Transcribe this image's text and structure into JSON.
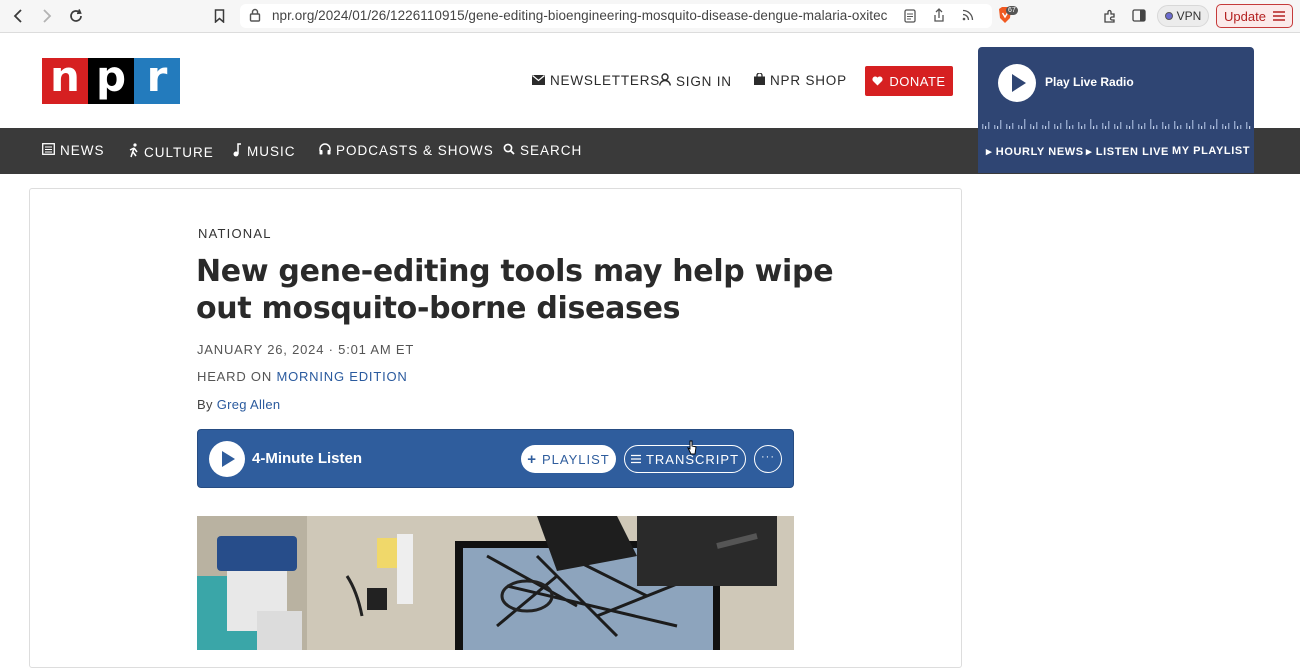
{
  "browser": {
    "url": "npr.org/2024/01/26/1226110915/gene-editing-bioengineering-mosquito-disease-dengue-malaria-oxitec",
    "shields_count": "67",
    "vpn_label": "VPN",
    "update_label": "Update"
  },
  "header": {
    "logo_letters": [
      "n",
      "p",
      "r"
    ],
    "newsletters_label": "NEWSLETTERS",
    "signin_label": "SIGN IN",
    "shop_label": "NPR SHOP",
    "donate_label": "DONATE"
  },
  "nav": {
    "items": [
      {
        "label": "NEWS",
        "icon": "news-icon"
      },
      {
        "label": "CULTURE",
        "icon": "culture-icon"
      },
      {
        "label": "MUSIC",
        "icon": "music-note-icon"
      },
      {
        "label": "PODCASTS & SHOWS",
        "icon": "headphones-icon"
      },
      {
        "label": "SEARCH",
        "icon": "search-icon"
      }
    ]
  },
  "radio": {
    "title": "Play Live Radio",
    "hourly_news": "HOURLY NEWS",
    "listen_live": "LISTEN LIVE",
    "my_playlist": "MY PLAYLIST"
  },
  "article": {
    "slug": "NATIONAL",
    "headline": "New gene-editing tools may help wipe out mosquito-borne diseases",
    "dateline": "JANUARY 26, 2024 · 5:01 AM ET",
    "heard_prefix": "HEARD ON ",
    "heard_show": "MORNING EDITION",
    "by_prefix": "By ",
    "author": "Greg Allen"
  },
  "player": {
    "title": "4-Minute Listen",
    "playlist_label": "PLAYLIST",
    "transcript_label": "TRANSCRIPT",
    "more_label": "···"
  },
  "colors": {
    "npr_red": "#d62021",
    "npr_blue": "#237bbd",
    "nav_bg": "#3a3a3a",
    "radio_bg": "#2f4573",
    "player_bg": "#2f5d9d",
    "link_blue": "#2a5a9e"
  }
}
